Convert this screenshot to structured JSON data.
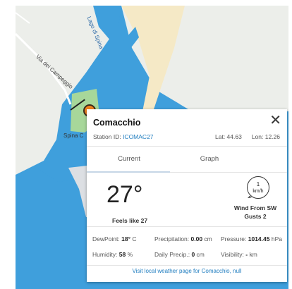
{
  "map": {
    "water_color": "#3f9fdc",
    "land_color": "#eceeea",
    "park_color": "#a7d79a",
    "labels": {
      "lake": "Lago di Spina",
      "road": "Via dei Campeggio",
      "place": "Spina C"
    },
    "marker_color": "#f0821e",
    "marker_icon": "station-marker-icon"
  },
  "popup": {
    "title": "Comacchio",
    "close_label": "✕",
    "station_prefix": "Station ID: ",
    "station_id": "ICOMAC27",
    "lat": "Lat: 44.63",
    "lon": "Lon: 12.26",
    "tabs": [
      {
        "label": "Current",
        "active": true
      },
      {
        "label": "Graph",
        "active": false
      }
    ],
    "temperature": "27°",
    "feels_like": "Feels like 27",
    "wind": {
      "speed": "1",
      "unit": "km/h",
      "direction_line": "Wind From SW",
      "gusts_line": "Gusts 2",
      "direction_icon": "wind-compass-icon"
    },
    "details": {
      "dewpoint_label": "DewPoint: ",
      "dewpoint_value": "18°",
      "dewpoint_unit": " C",
      "precip_label": "Precipitation: ",
      "precip_value": "0.00",
      "precip_unit": " cm",
      "pressure_label": "Pressure: ",
      "pressure_value": "1014.45",
      "pressure_unit": " hPa",
      "humidity_label": "Humidity: ",
      "humidity_value": "58",
      "humidity_unit": " %",
      "daily_precip_label": "Daily Precip.: ",
      "daily_precip_value": "0",
      "daily_precip_unit": " cm",
      "visibility_label": "Visibility: ",
      "visibility_value": "-",
      "visibility_unit": " km"
    },
    "footer_link": "Visit local weather page for Comacchio, null",
    "link_color": "#1e7cbf"
  }
}
